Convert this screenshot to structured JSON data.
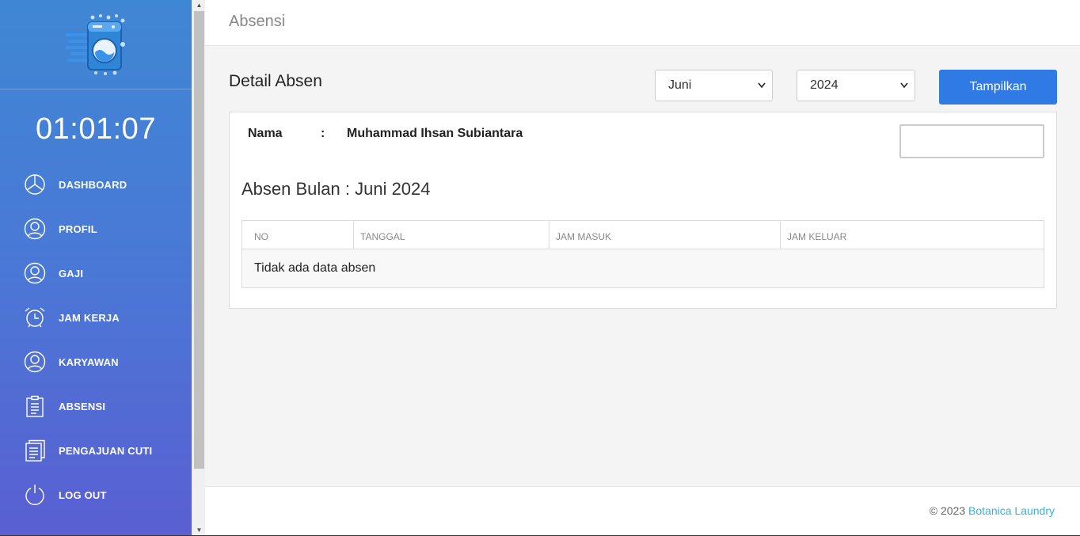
{
  "header": {
    "title": "Absensi"
  },
  "sidebar": {
    "logo_icon": "washing-machine-icon",
    "clock": "01:01:07",
    "items": [
      {
        "label": "DASHBOARD",
        "icon": "pie-chart-icon"
      },
      {
        "label": "PROFIL",
        "icon": "user-circle-icon"
      },
      {
        "label": "GAJI",
        "icon": "user-circle-icon"
      },
      {
        "label": "JAM KERJA",
        "icon": "alarm-clock-icon"
      },
      {
        "label": "KARYAWAN",
        "icon": "user-circle-icon"
      },
      {
        "label": "ABSENSI",
        "icon": "clipboard-icon"
      },
      {
        "label": "PENGAJUAN CUTI",
        "icon": "document-icon"
      },
      {
        "label": "LOG OUT",
        "icon": "power-icon"
      }
    ]
  },
  "detail": {
    "title": "Detail Absen",
    "month_select": {
      "value": "Juni"
    },
    "year_select": {
      "value": "2024"
    },
    "show_button": "Tampilkan",
    "name_label": "Nama",
    "name_colon": ":",
    "name_value": "Muhammad Ihsan Subiantara",
    "search_value": "",
    "month_heading": "Absen Bulan : Juni 2024",
    "table": {
      "columns": [
        "NO",
        "TANGGAL",
        "JAM MASUK",
        "JAM KELUAR"
      ],
      "empty_message": "Tidak ada data absen"
    }
  },
  "footer": {
    "copyright": "© 2023",
    "brand": "Botanica Laundry"
  },
  "colors": {
    "accent": "#2f7ae5",
    "sidebar_top": "#3f87d4",
    "sidebar_bottom": "#5a5fd2",
    "link": "#37b4d6"
  }
}
